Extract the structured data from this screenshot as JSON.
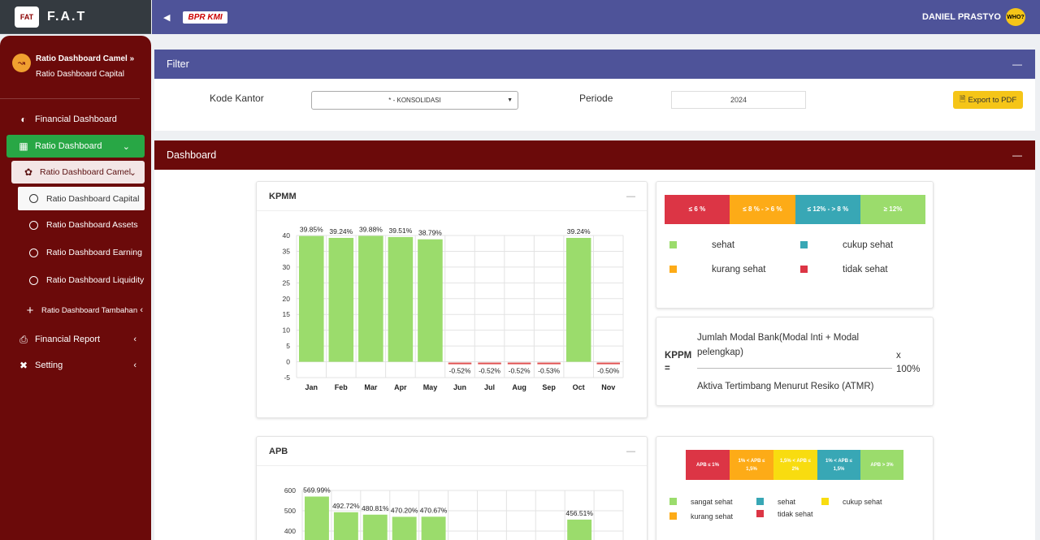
{
  "brand": {
    "title": "F.A.T",
    "logo_text": "FAT"
  },
  "topbar": {
    "bank_logo": "BPR KMI",
    "user_name": "DANIEL PRASTYO",
    "avatar_text": "WHO?"
  },
  "sidebar": {
    "user_panel": {
      "line1": "Ratio Dashboard Camel »",
      "line2": "Ratio Dashboard Capital"
    },
    "items": [
      {
        "label": "Financial Dashboard",
        "icon": "dashboard-icon"
      },
      {
        "label": "Ratio Dashboard",
        "icon": "chart-bar-icon"
      },
      {
        "label": "Ratio Dashboard Camel",
        "icon": "paw-icon"
      },
      {
        "label": "Ratio Dashboard Capital"
      },
      {
        "label": "Ratio Dashboard Assets"
      },
      {
        "label": "Ratio Dashboard Earning"
      },
      {
        "label": "Ratio Dashboard Liquidity"
      },
      {
        "label": "Ratio Dashboard Tambahan",
        "icon": "plus-icon"
      },
      {
        "label": "Financial Report",
        "icon": "print-icon"
      },
      {
        "label": "Setting",
        "icon": "tools-icon"
      }
    ]
  },
  "filter": {
    "title": "Filter",
    "kode_kantor_label": "Kode Kantor",
    "kode_kantor_value": "* - KONSOLIDASI",
    "periode_label": "Periode",
    "periode_value": "2024",
    "export_label": "Export to PDF"
  },
  "dashboard": {
    "title": "Dashboard"
  },
  "kpmm": {
    "title": "KPMM",
    "legend_bar": [
      "≤ 6 %",
      "≤ 8 % - > 6 %",
      "≤ 12% - > 8 %",
      "≥ 12%"
    ],
    "legend_colors": [
      "#dc3545",
      "#fdab17",
      "#38a7b5",
      "#9bdc6c"
    ],
    "legend_items": [
      "sehat",
      "cukup sehat",
      "kurang sehat",
      "tidak sehat"
    ],
    "formula": {
      "label": "KPPM",
      "eq": "=",
      "numerator": "Jumlah Modal Bank(Modal Inti + Modal pelengkap)",
      "times": "x",
      "percent": "100%",
      "denominator": "Aktiva Tertimbang Menurut Resiko (ATMR)"
    }
  },
  "apb": {
    "title": "APB",
    "legend_bar": [
      "APB ≤ 1%",
      "1% < APB ≤ 1,5%",
      "1,5% < APB ≤ 2%",
      "1% < APB ≤ 1,5%",
      "APB > 3%"
    ],
    "legend_colors": [
      "#dc3545",
      "#fdab17",
      "#f8dc10",
      "#38a7b5",
      "#9bdc6c"
    ],
    "legend_items": [
      "sangat sehat",
      "sehat",
      "cukup sehat",
      "kurang sehat",
      "tidak sehat"
    ]
  },
  "chart_data": [
    {
      "type": "bar",
      "title": "KPMM",
      "categories": [
        "Jan",
        "Feb",
        "Mar",
        "Apr",
        "May",
        "Jun",
        "Jul",
        "Aug",
        "Sep",
        "Oct",
        "Nov"
      ],
      "values": [
        39.85,
        39.24,
        39.88,
        39.51,
        38.79,
        -0.52,
        -0.52,
        -0.52,
        -0.53,
        39.24,
        -0.5
      ],
      "labels": [
        "39.85%",
        "39.24%",
        "39.88%",
        "39.51%",
        "38.79%",
        "-0.52%",
        "-0.52%",
        "-0.52%",
        "-0.53%",
        "39.24%",
        "-0.50%"
      ],
      "yticks": [
        "40",
        "35",
        "30",
        "25",
        "20",
        "15",
        "10",
        "5",
        "0",
        "-5"
      ],
      "ylim": [
        -5,
        40
      ],
      "grid": true
    },
    {
      "type": "bar",
      "title": "APB",
      "values": [
        569.99,
        492.72,
        480.81,
        470.2,
        470.67,
        null,
        null,
        null,
        null,
        456.51,
        null
      ],
      "labels": [
        "569.99%",
        "492.72%",
        "480.81%",
        "470.20%",
        "470.67%",
        "",
        "",
        "",
        "",
        "456.51%",
        ""
      ],
      "yticks": [
        "600",
        "500",
        "400"
      ],
      "ylim": [
        0,
        600
      ],
      "grid": true
    }
  ]
}
